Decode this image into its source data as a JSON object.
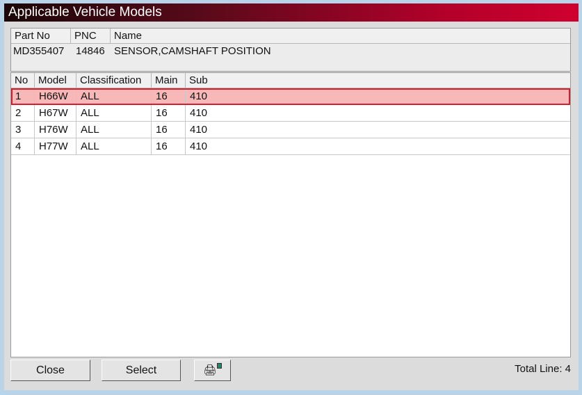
{
  "title": "Applicable Vehicle Models",
  "part": {
    "headers": [
      "Part No",
      "PNC",
      "Name"
    ],
    "values": [
      "MD355407",
      "14846",
      "SENSOR,CAMSHAFT POSITION"
    ]
  },
  "table": {
    "headers": [
      "No",
      "Model",
      "Classification",
      "Main",
      "Sub"
    ],
    "rows": [
      [
        "1",
        "H66W",
        "ALL",
        "16",
        "410"
      ],
      [
        "2",
        "H67W",
        "ALL",
        "16",
        "410"
      ],
      [
        "3",
        "H76W",
        "ALL",
        "16",
        "410"
      ],
      [
        "4",
        "H77W",
        "ALL",
        "16",
        "410"
      ]
    ]
  },
  "buttons": {
    "close": "Close",
    "select": "Select"
  },
  "total": "Total Line: 4"
}
